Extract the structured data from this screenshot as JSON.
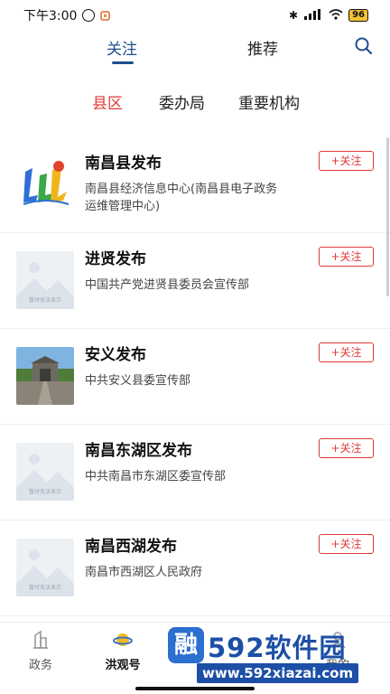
{
  "status_bar": {
    "time": "下午3:00",
    "battery": "96"
  },
  "top_tabs": [
    {
      "label": "关注",
      "active": true
    },
    {
      "label": "推荐",
      "active": false
    }
  ],
  "sub_tabs": [
    {
      "label": "县区",
      "active": true
    },
    {
      "label": "委办局",
      "active": false
    },
    {
      "label": "重要机构",
      "active": false
    }
  ],
  "placeholder_text": "暂时无法显示",
  "items": [
    {
      "title": "南昌县发布",
      "desc": "南昌县经济信息中心(南昌县电子政务运维管理中心)",
      "follow_label": "+关注",
      "thumb": "logo"
    },
    {
      "title": "进贤发布",
      "desc": "中国共产党进贤县委员会宣传部",
      "follow_label": "+关注",
      "thumb": "placeholder"
    },
    {
      "title": "安义发布",
      "desc": "中共安义县委宣传部",
      "follow_label": "+关注",
      "thumb": "photo"
    },
    {
      "title": "南昌东湖区发布",
      "desc": "中共南昌市东湖区委宣传部",
      "follow_label": "+关注",
      "thumb": "placeholder"
    },
    {
      "title": "南昌西湖发布",
      "desc": "南昌市西湖区人民政府",
      "follow_label": "+关注",
      "thumb": "placeholder"
    }
  ],
  "bottom_nav": [
    {
      "label": "政务"
    },
    {
      "label": "洪观号"
    },
    {
      "label": "我的"
    }
  ],
  "watermark": {
    "logo": "融",
    "big_text": "592软件园",
    "url": "www.592xiazai.com"
  },
  "colors": {
    "accent_blue": "#1f4e8c",
    "accent_red": "#e03a3a"
  }
}
